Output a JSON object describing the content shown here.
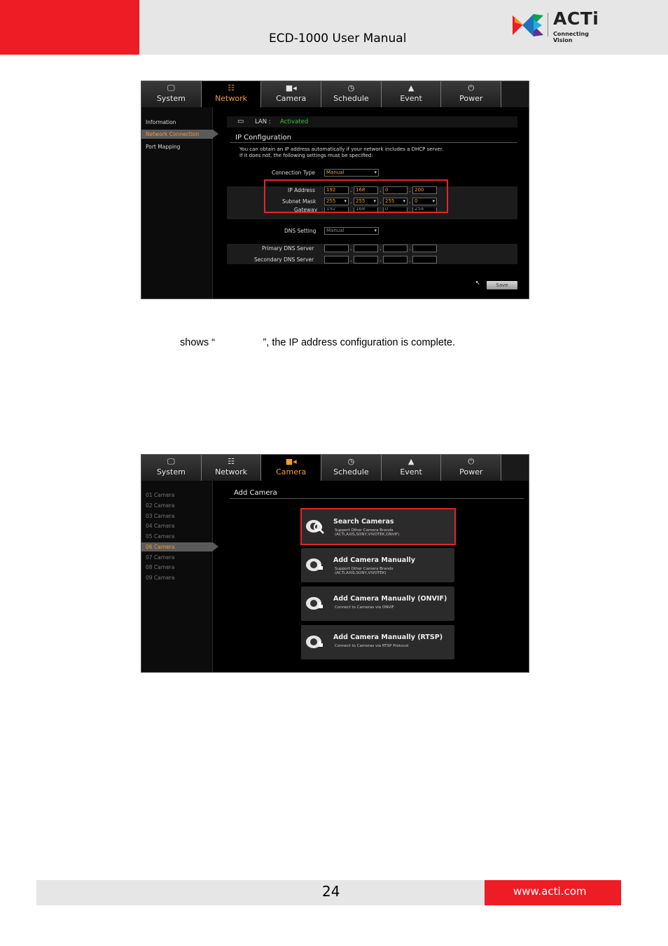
{
  "header": {
    "title": "ECD-1000 User Manual",
    "logo": {
      "name": "ACTi",
      "tagline": "Connecting Vision"
    },
    "colors": {
      "brand_red": "#ee1c25",
      "band_grey": "#e6e6e6"
    }
  },
  "tabs": [
    {
      "label": "System",
      "icon": "monitor-icon"
    },
    {
      "label": "Network",
      "icon": "network-icon"
    },
    {
      "label": "Camera",
      "icon": "camera-icon"
    },
    {
      "label": "Schedule",
      "icon": "clock-icon"
    },
    {
      "label": "Event",
      "icon": "warning-icon"
    },
    {
      "label": "Power",
      "icon": "power-icon"
    }
  ],
  "network_panel": {
    "active_tab": "Network",
    "sidebar": [
      "Information",
      "Network Connection",
      "Port Mapping"
    ],
    "selected_sidebar": "Network Connection",
    "lan_label": "LAN :",
    "lan_status": "Activated",
    "section_title": "IP Configuration",
    "description_line1": "You can obtain an IP address automatically if your network includes a DHCP server.",
    "description_line2": "If it does not, the following settings must be specified:",
    "connection_type_label": "Connection Type",
    "connection_type_value": "Manual",
    "ip_address_label": "IP Address",
    "ip_address": [
      "192",
      "168",
      "0",
      "200"
    ],
    "subnet_mask_label": "Subnet Mask",
    "subnet_mask": [
      "255",
      "255",
      "255",
      "0"
    ],
    "gateway_label": "Gateway",
    "gateway": [
      "192",
      "168",
      "0",
      "254"
    ],
    "dns_setting_label": "DNS Setting",
    "dns_setting_value": "Manual",
    "primary_dns_label": "Primary DNS Server",
    "secondary_dns_label": "Secondary DNS Server",
    "save_label": "Save"
  },
  "body_text": "shows “                 ”, the IP address configuration is complete.",
  "camera_panel": {
    "active_tab": "Camera",
    "sidebar": [
      "01 Camera",
      "02 Camera",
      "03 Camera",
      "04 Camera",
      "05 Camera",
      "06 Camera",
      "07 Camera",
      "08 Camera",
      "09 Camera"
    ],
    "selected_sidebar": "06 Camera",
    "section_title": "Add Camera",
    "options": [
      {
        "title": "Search Cameras",
        "sub1": "Support Other Camera Brands",
        "sub2": "(ACTi,AXIS,SONY,VIVOTEK,ONVIF)"
      },
      {
        "title": "Add Camera Manually",
        "sub1": "Support Other Camera Brands",
        "sub2": "(ACTi,AXIS,SONY,VIVOTEK)"
      },
      {
        "title": "Add Camera Manually (ONVIF)",
        "sub1": "Connect to Cameras via ONVIF",
        "sub2": ""
      },
      {
        "title": "Add Camera Manually (RTSP)",
        "sub1": "Connect to Cameras via RTSP Protocol",
        "sub2": ""
      }
    ]
  },
  "footer": {
    "page_number": "24",
    "url": "www.acti.com"
  }
}
